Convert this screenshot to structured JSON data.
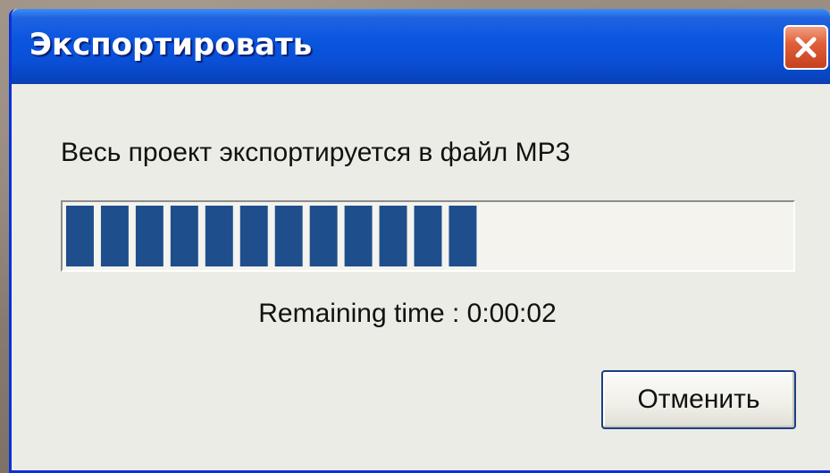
{
  "window": {
    "title": "Экспортировать"
  },
  "message": "Весь проект экспортируется в файл MP3",
  "progress": {
    "fraction": 0.57,
    "total_blocks": 21,
    "filled_blocks": 12,
    "fill_color": "#1f4e8c"
  },
  "remaining_time": "Remaining time : 0:00:02",
  "buttons": {
    "cancel_label": "Отменить"
  },
  "icons": {
    "close": "close-icon"
  }
}
